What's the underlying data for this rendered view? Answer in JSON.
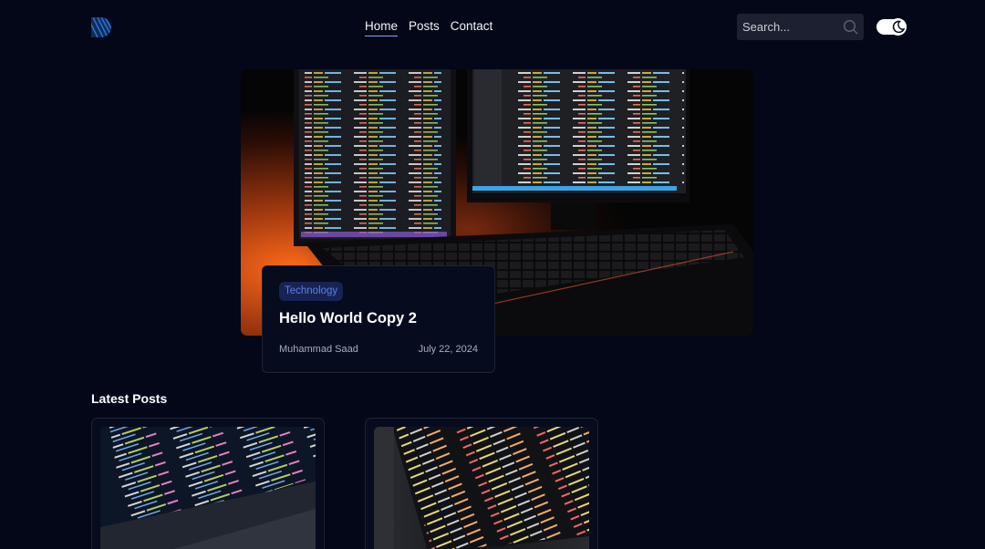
{
  "header": {
    "nav": [
      {
        "label": "Home",
        "active": true
      },
      {
        "label": "Posts",
        "active": false
      },
      {
        "label": "Contact",
        "active": false
      }
    ],
    "search": {
      "placeholder": "Search..."
    }
  },
  "hero": {
    "category": "Technology",
    "title": "Hello World Copy 2",
    "author": "Muhammad Saad",
    "date": "July 22, 2024"
  },
  "latest": {
    "title": "Latest Posts"
  },
  "colors": {
    "background": "#030717",
    "card": "#060b1d",
    "tag_bg": "#172352",
    "tag_text": "#5b7ff0",
    "accent_underline": "#8aa0ff"
  }
}
